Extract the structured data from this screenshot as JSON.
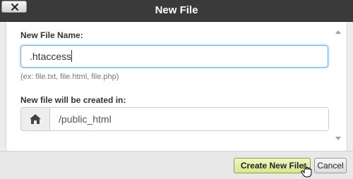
{
  "dialog": {
    "title": "New File",
    "close_icon": "close-x-icon"
  },
  "form": {
    "name_label": "New File Name:",
    "name_value": ".htaccess",
    "name_hint": "(ex: file.txt, file.html, file.php)",
    "location_label": "New file will be created in:",
    "location_icon": "home-icon",
    "location_value": "/public_html"
  },
  "footer": {
    "create_label": "Create New File",
    "cancel_label": "Cancel"
  },
  "colors": {
    "titlebar": "#3a3a3a",
    "create_button": "#d8e78a",
    "focus_border": "#66afe9"
  }
}
